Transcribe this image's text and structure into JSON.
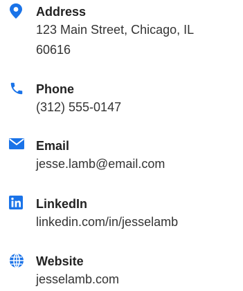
{
  "accent_color": "#1a73e8",
  "contacts": [
    {
      "icon": "map-pin-icon",
      "label": "Address",
      "value_lines": [
        "123 Main Street, Chicago, IL",
        "60616"
      ]
    },
    {
      "icon": "phone-icon",
      "label": "Phone",
      "value_lines": [
        "(312) 555-0147"
      ]
    },
    {
      "icon": "envelope-icon",
      "label": "Email",
      "value_lines": [
        "jesse.lamb@email.com"
      ]
    },
    {
      "icon": "linkedin-icon",
      "label": "LinkedIn",
      "value_lines": [
        "linkedin.com/in/jesselamb"
      ]
    },
    {
      "icon": "globe-icon",
      "label": "Website",
      "value_lines": [
        "jesselamb.com"
      ]
    }
  ]
}
